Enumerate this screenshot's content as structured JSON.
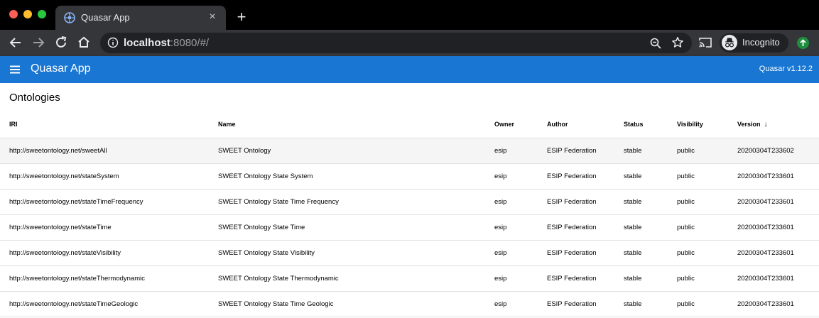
{
  "browser": {
    "tab_title": "Quasar App",
    "tab_close": "×",
    "new_tab": "+",
    "url_host": "localhost",
    "url_rest": ":8080/#/",
    "profile_label": "Incognito"
  },
  "app": {
    "title": "Quasar App",
    "version": "Quasar v1.12.2"
  },
  "table": {
    "title": "Ontologies",
    "columns": [
      "IRI",
      "Name",
      "Owner",
      "Author",
      "Status",
      "Visibility",
      "Version"
    ],
    "sort_indicator": "↓",
    "rows": [
      [
        "http://sweetontology.net/sweetAll",
        "SWEET Ontology",
        "esip",
        "ESIP Federation",
        "stable",
        "public",
        "20200304T233602"
      ],
      [
        "http://sweetontology.net/stateSystem",
        "SWEET Ontology State System",
        "esip",
        "ESIP Federation",
        "stable",
        "public",
        "20200304T233601"
      ],
      [
        "http://sweetontology.net/stateTimeFrequency",
        "SWEET Ontology State Time Frequency",
        "esip",
        "ESIP Federation",
        "stable",
        "public",
        "20200304T233601"
      ],
      [
        "http://sweetontology.net/stateTime",
        "SWEET Ontology State Time",
        "esip",
        "ESIP Federation",
        "stable",
        "public",
        "20200304T233601"
      ],
      [
        "http://sweetontology.net/stateVisibility",
        "SWEET Ontology State Visibility",
        "esip",
        "ESIP Federation",
        "stable",
        "public",
        "20200304T233601"
      ],
      [
        "http://sweetontology.net/stateThermodynamic",
        "SWEET Ontology State Thermodynamic",
        "esip",
        "ESIP Federation",
        "stable",
        "public",
        "20200304T233601"
      ],
      [
        "http://sweetontology.net/stateTimeGeologic",
        "SWEET Ontology State Time Geologic",
        "esip",
        "ESIP Federation",
        "stable",
        "public",
        "20200304T233601"
      ]
    ]
  },
  "colors": {
    "header_bg": "#1976d2",
    "row_hover": "#f5f5f5"
  }
}
